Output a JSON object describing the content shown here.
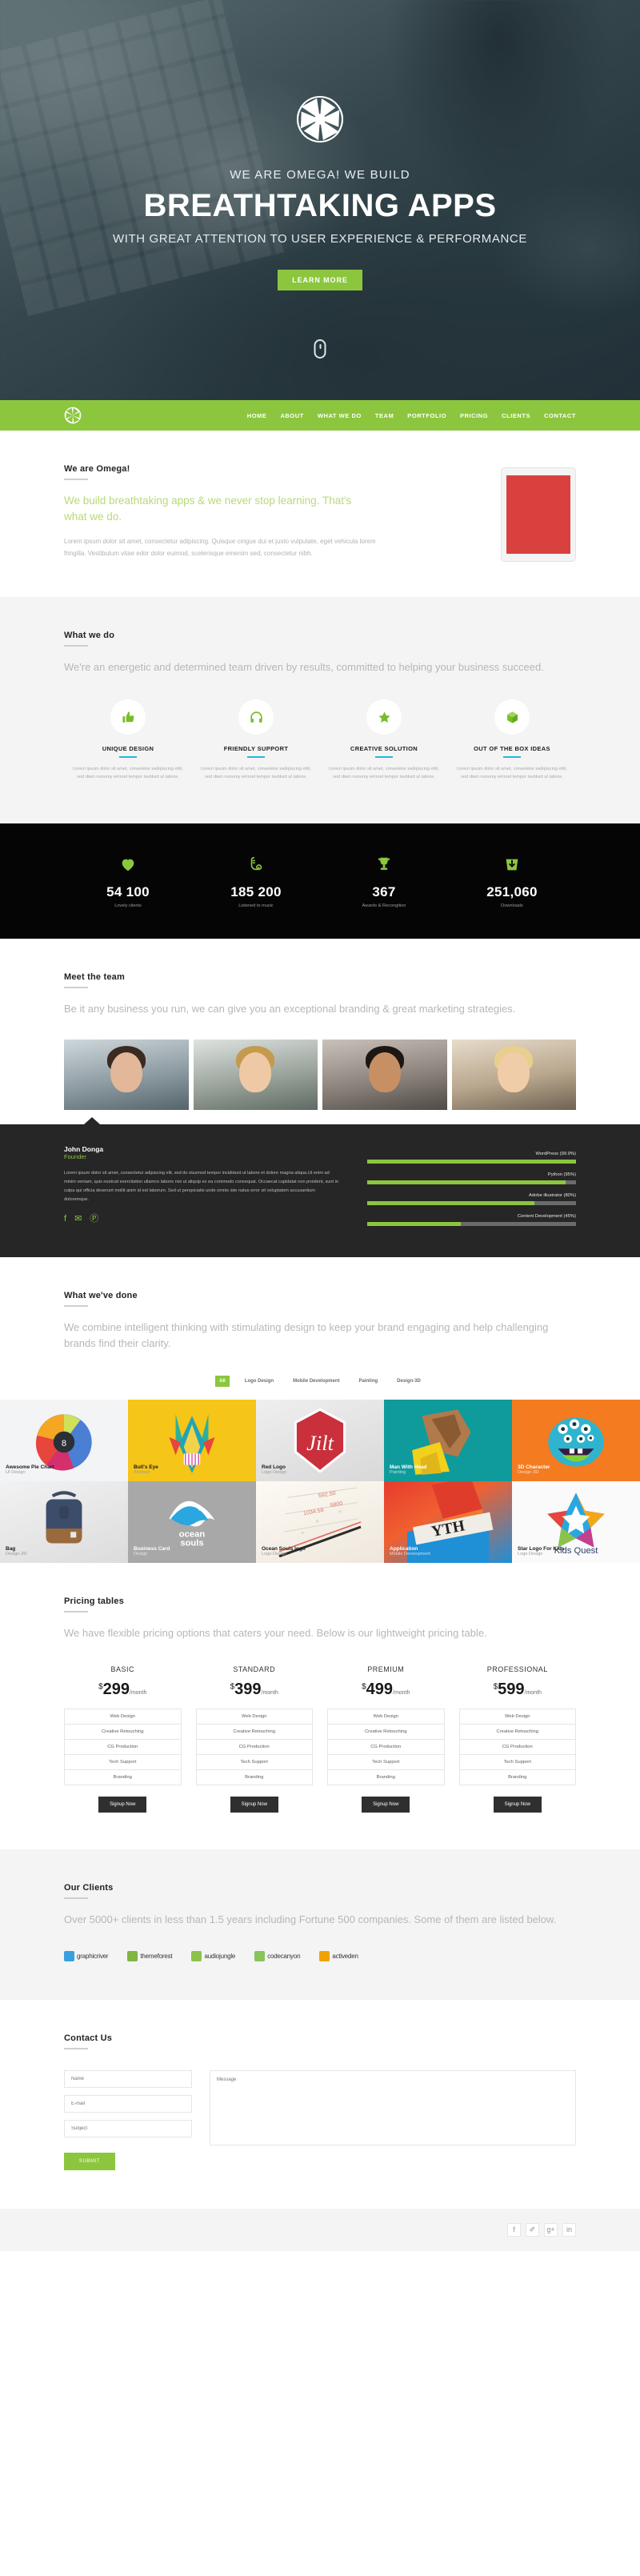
{
  "hero": {
    "logo_icon": "aperture-logo-icon",
    "kicker": "WE ARE OMEGA! WE BUILD",
    "title": "BREATHTAKING APPS",
    "subtitle": "WITH GREAT ATTENTION TO USER EXPERIENCE & PERFORMANCE",
    "cta_label": "LEARN MORE",
    "scroll_hint_icon": "mouse-scroll-icon",
    "accent_color": "#8cc63e"
  },
  "nav": {
    "logo_icon": "aperture-logo-icon",
    "background": "#8cc63e",
    "items": [
      {
        "label": "HOME"
      },
      {
        "label": "ABOUT"
      },
      {
        "label": "WHAT WE DO"
      },
      {
        "label": "TEAM"
      },
      {
        "label": "PORTFOLIO"
      },
      {
        "label": "PRICING"
      },
      {
        "label": "CLIENTS"
      },
      {
        "label": "CONTACT"
      }
    ]
  },
  "about": {
    "title": "We are Omega!",
    "tagline": "We build breathtaking apps & we never stop learning. That's what we do.",
    "copy": "Lorem ipsum dolor sit amet, consectetur adipiscing. Quisque cingue dui et justo vulputate, eget vehicula lorem fringilla. Vestibulum vitae edor dolor euimod, scelerisque emenim sed, consectetur nibh.",
    "device_icon": "tablet-device-icon",
    "device_screen_color": "#d9413f"
  },
  "whatwedo": {
    "title": "What we do",
    "lead": "We're an energetic and determined team driven by results, committed to helping your business succeed.",
    "underline_color": "#29b6d8",
    "features": [
      {
        "icon": "thumbs-up-icon",
        "name": "UNIQUE DESIGN",
        "copy": "Lorem ipsum dolor sit amet, consetetur sadipiscing elitr, sed diam nonumy eirmod tempor invidunt ut labore."
      },
      {
        "icon": "headphones-icon",
        "name": "FRIENDLY SUPPORT",
        "copy": "Lorem ipsum dolor sit amet, consetetur sadipiscing elitr, sed diam nonumy eirmod tempor invidunt ut labore."
      },
      {
        "icon": "star-icon",
        "name": "CREATIVE SOLUTION",
        "copy": "Lorem ipsum dolor sit amet, consetetur sadipiscing elitr, sed diam nonumy eirmod tempor invidunt ut labore."
      },
      {
        "icon": "cube-box-icon",
        "name": "OUT OF THE BOX IDEAS",
        "copy": "Lorem ipsum dolor sit amet, consetetur sadipiscing elitr, sed diam nonumy eirmod tempor invidunt ut labore."
      }
    ]
  },
  "counters": {
    "background": "#050505",
    "items": [
      {
        "icon": "heart-icon",
        "number": "54 100",
        "label": "Lovely clients"
      },
      {
        "icon": "saxophone-icon",
        "number": "185 200",
        "label": "Listened to music"
      },
      {
        "icon": "trophy-icon",
        "number": "367",
        "label": "Awards & Recongition"
      },
      {
        "icon": "download-bag-icon",
        "number": "251,060",
        "label": "Downloads"
      }
    ]
  },
  "team": {
    "title": "Meet the team",
    "lead": "Be it any business you run, we can give you an exceptional branding & great marketing strategies.",
    "members": [
      {
        "photo": "team-member-photo-1"
      },
      {
        "photo": "team-member-photo-2"
      },
      {
        "photo": "team-member-photo-3"
      },
      {
        "photo": "team-member-photo-4"
      }
    ],
    "founder": {
      "name": "John Donga",
      "role": "Founder",
      "bio": "Lorem ipsum dolor sit amet, consectetur adipiscing elit, sed do eiusmod tempor incididunt ut labore et dolore magna aliqua.Ut enim ad minim veniam, quis nostrud exercitation ullamco laboris nisi ut aliquip ex ea commodo consequat. Occaecat cupidatat non proident, sunt in culpa qui officia deserunt mollit anim id est laborum. Sed ut perspiciatis unde omnis iste natus error sit voluptatem accusantium doloremque.",
      "social": [
        {
          "icon": "facebook-icon",
          "glyph": "f"
        },
        {
          "icon": "twitter-icon",
          "glyph": "✉"
        },
        {
          "icon": "pinterest-icon",
          "glyph": "Ⓟ"
        }
      ],
      "skills": [
        {
          "label": "WordPress (99.9%)",
          "value": 99.9
        },
        {
          "label": "Python (95%)",
          "value": 95
        },
        {
          "label": "Adobe illustrator (80%)",
          "value": 80
        },
        {
          "label": "Content Development (45%)",
          "value": 45
        }
      ]
    }
  },
  "portfolio": {
    "title": "What we've done",
    "lead": "We combine intelligent thinking with stimulating design to keep your brand engaging and help challenging brands find their clarity.",
    "filters": [
      {
        "label": "All",
        "active": true
      },
      {
        "label": "Logo Design",
        "active": false
      },
      {
        "label": "Mobile Development",
        "active": false
      },
      {
        "label": "Painting",
        "active": false
      },
      {
        "label": "Design-3D",
        "active": false
      }
    ],
    "items": [
      {
        "title": "Awesome Pie Chart",
        "category": "UI Design",
        "theme": "t-pie",
        "light": false
      },
      {
        "title": "Bull's Eye",
        "category": "Abstract",
        "theme": "t-bull",
        "light": false
      },
      {
        "title": "Red Logo",
        "category": "Logo Design",
        "theme": "t-red",
        "light": false
      },
      {
        "title": "Man With Head",
        "category": "Painting",
        "theme": "t-man",
        "light": true
      },
      {
        "title": "3D Character",
        "category": "Design-3D",
        "theme": "t-3d",
        "light": true
      },
      {
        "title": "Bag",
        "category": "Design-3D",
        "theme": "t-bag",
        "light": false
      },
      {
        "title": "Business Card",
        "category": "Design",
        "theme": "t-card",
        "light": true
      },
      {
        "title": "Ocean Souls logo",
        "category": "Logo Design",
        "theme": "t-ocean",
        "light": false
      },
      {
        "title": "Application",
        "category": "Mobile Development",
        "theme": "t-app",
        "light": true
      },
      {
        "title": "Star Logo For Kids",
        "category": "Logo Design",
        "theme": "t-star",
        "light": false
      }
    ]
  },
  "pricing": {
    "title": "Pricing tables",
    "lead": "We have flexible pricing options that caters your need. Below is our lightweight pricing table.",
    "currency": "$",
    "period": "/month",
    "button_label": "Signup Now",
    "features": [
      "Web Design",
      "Creative Retouching",
      "CG Production",
      "Tech Support",
      "Branding"
    ],
    "plans": [
      {
        "name": "BASIC",
        "amount": "299"
      },
      {
        "name": "STANDARD",
        "amount": "399"
      },
      {
        "name": "PREMIUM",
        "amount": "499"
      },
      {
        "name": "PROFESSIONAL",
        "amount": "599"
      }
    ]
  },
  "clients": {
    "title": "Our Clients",
    "lead": "Over 5000+ clients in less than 1.5 years including Fortune 500 companies. Some of them are listed below.",
    "logos": [
      {
        "name": "graphicriver",
        "icon": "graphicriver-icon",
        "color": "#3aa0dd"
      },
      {
        "name": "themeforest",
        "icon": "themeforest-icon",
        "color": "#81b441"
      },
      {
        "name": "audiojungle",
        "icon": "audiojungle-icon",
        "color": "#8bc34a"
      },
      {
        "name": "codecanyon",
        "icon": "codecanyon-icon",
        "color": "#8ac35a"
      },
      {
        "name": "activeden",
        "icon": "activeden-icon",
        "color": "#f0a202"
      }
    ]
  },
  "contact": {
    "title": "Contact Us",
    "fields": {
      "name_placeholder": "Name",
      "email_placeholder": "E-mail",
      "subject_placeholder": "Subject",
      "message_placeholder": "Message"
    },
    "submit_label": "SUBMIT"
  },
  "footer": {
    "social": [
      {
        "icon": "facebook-icon",
        "glyph": "f"
      },
      {
        "icon": "twitter-icon",
        "glyph": "✐"
      },
      {
        "icon": "google-plus-icon",
        "glyph": "g+"
      },
      {
        "icon": "linkedin-icon",
        "glyph": "in"
      }
    ]
  }
}
